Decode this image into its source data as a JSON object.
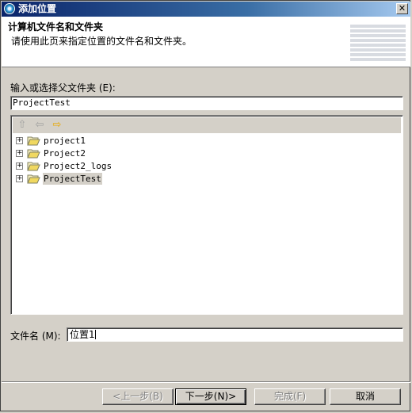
{
  "window": {
    "title": "添加位置",
    "close_glyph": "✕"
  },
  "banner": {
    "title": "计算机文件名和文件夹",
    "description": "请使用此页来指定位置的文件名和文件夹。"
  },
  "parent_folder": {
    "label": "输入或选择父文件夹 (E):",
    "value": "ProjectTest"
  },
  "toolbar": {
    "up": "⇧",
    "back": "⇦",
    "forward": "⇨"
  },
  "tree": {
    "items": [
      {
        "label": "project1",
        "selected": false
      },
      {
        "label": "Project2",
        "selected": false
      },
      {
        "label": "Project2_logs",
        "selected": false
      },
      {
        "label": "ProjectTest",
        "selected": true
      }
    ]
  },
  "file_name": {
    "label": "文件名 (M):",
    "value": "位置1"
  },
  "buttons": {
    "back": "<上一步(B)",
    "next": "下一步(N)>",
    "finish": "完成(F)",
    "cancel": "取消"
  }
}
